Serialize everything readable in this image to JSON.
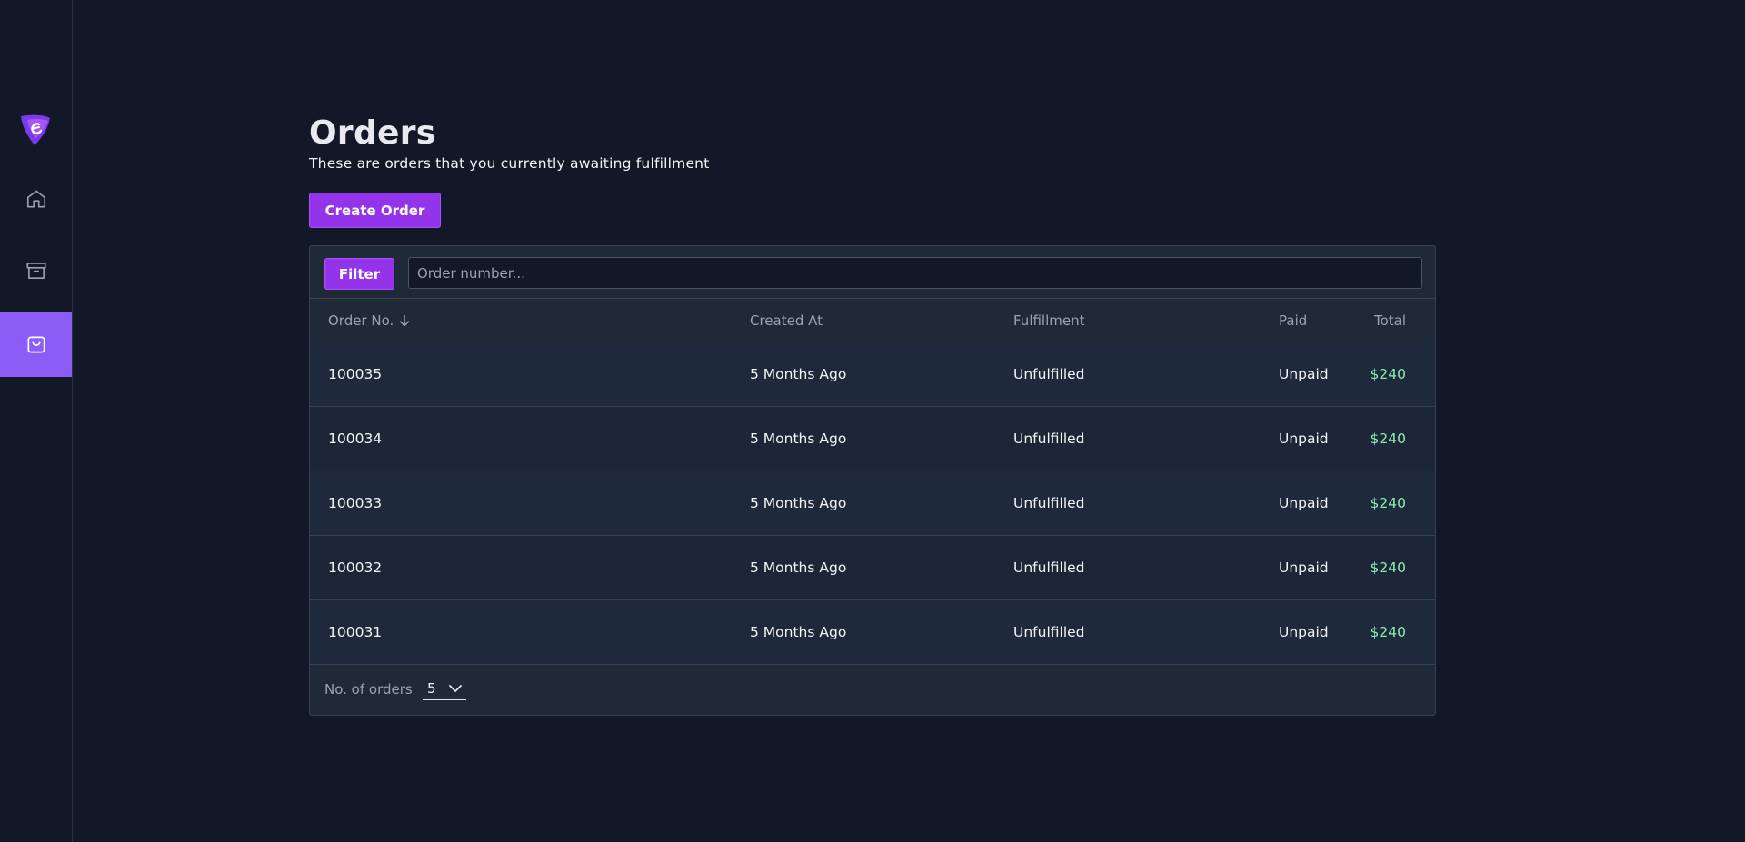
{
  "sidebar": {
    "items": [
      {
        "name": "home",
        "icon": "home-icon",
        "active": false
      },
      {
        "name": "products",
        "icon": "archive-box-icon",
        "active": false
      },
      {
        "name": "orders",
        "icon": "shopping-bag-icon",
        "active": true
      }
    ]
  },
  "page": {
    "title": "Orders",
    "subtitle": "These are orders that you currently awaiting fulfillment",
    "create_button": "Create Order"
  },
  "filter": {
    "button_label": "Filter",
    "search_placeholder": "Order number..."
  },
  "table": {
    "columns": [
      "Order No.",
      "Created At",
      "Fulfillment",
      "Paid",
      "Total"
    ],
    "sort": {
      "column": "Order No.",
      "direction": "descending"
    },
    "rows": [
      {
        "order_no": "100035",
        "created_at": "5 Months Ago",
        "fulfillment": "Unfulfilled",
        "paid": "Unpaid",
        "total": "$240"
      },
      {
        "order_no": "100034",
        "created_at": "5 Months Ago",
        "fulfillment": "Unfulfilled",
        "paid": "Unpaid",
        "total": "$240"
      },
      {
        "order_no": "100033",
        "created_at": "5 Months Ago",
        "fulfillment": "Unfulfilled",
        "paid": "Unpaid",
        "total": "$240"
      },
      {
        "order_no": "100032",
        "created_at": "5 Months Ago",
        "fulfillment": "Unfulfilled",
        "paid": "Unpaid",
        "total": "$240"
      },
      {
        "order_no": "100031",
        "created_at": "5 Months Ago",
        "fulfillment": "Unfulfilled",
        "paid": "Unpaid",
        "total": "$240"
      }
    ]
  },
  "footer": {
    "page_size_label": "No. of orders",
    "page_size_value": "5"
  },
  "colors": {
    "accent": "#9333ea",
    "active_nav": "#8b5cf6",
    "total_text": "#86efac",
    "background": "#121827"
  }
}
